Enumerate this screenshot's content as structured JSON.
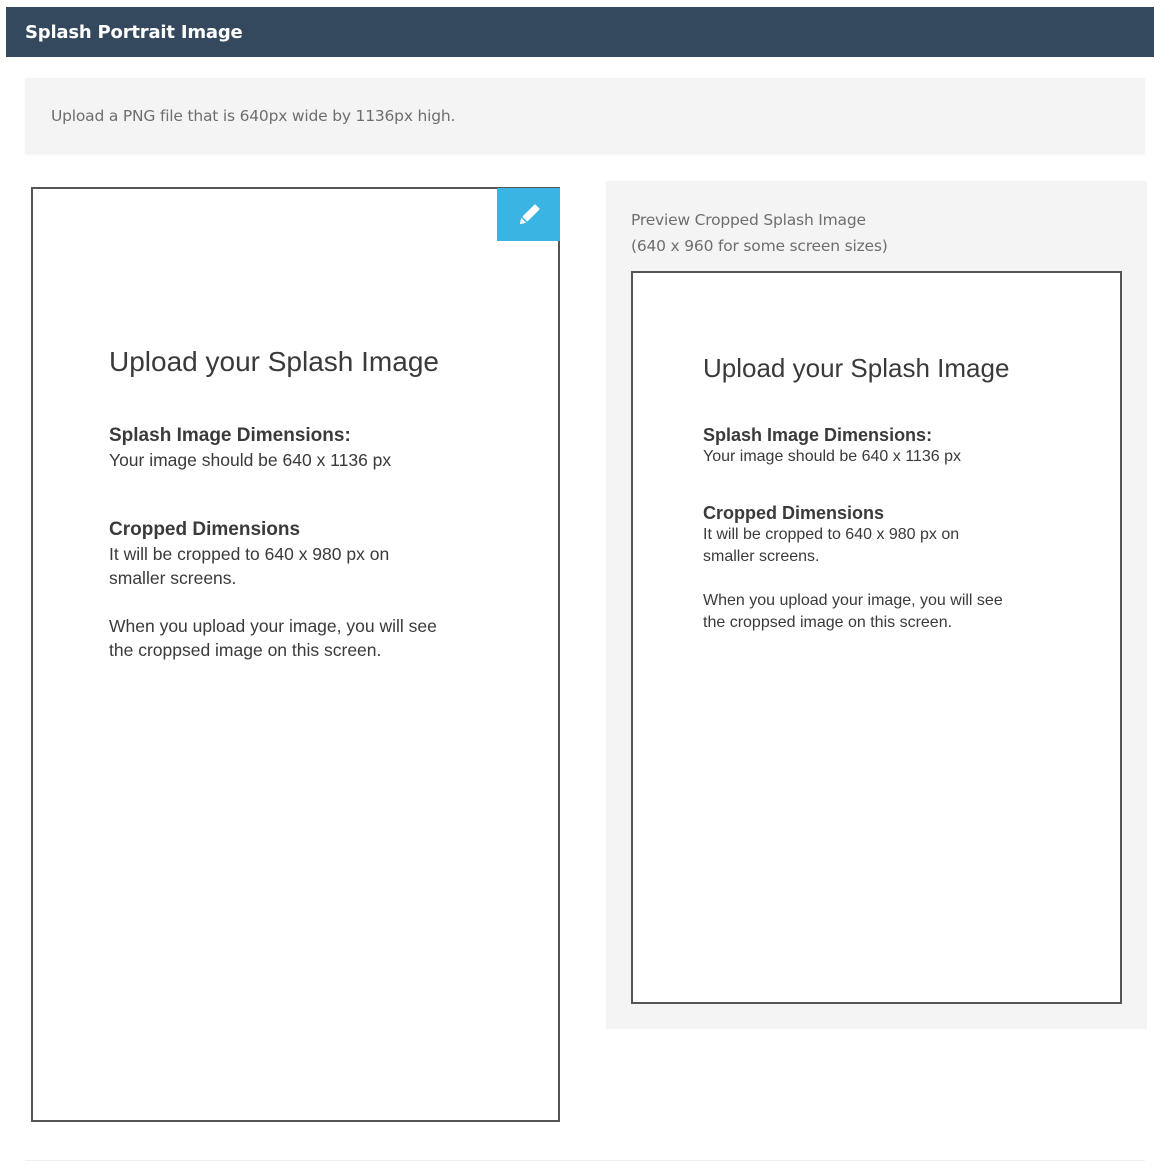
{
  "header": {
    "title": "Splash Portrait Image"
  },
  "info": {
    "text": "Upload a PNG file that is 640px wide by 1136px high."
  },
  "editor": {
    "edit_icon": "pencil-icon",
    "accent_color": "#3ab4e2"
  },
  "splash": {
    "heading": "Upload your Splash Image",
    "dimensions_title": "Splash Image Dimensions:",
    "dimensions_text": "Your image should be 640 x 1136 px",
    "cropped_title": "Cropped Dimensions",
    "cropped_text_line1": "It will be cropped to 640 x 980 px on",
    "cropped_text_line2": "smaller screens.",
    "note_line1": "When you upload your image, you will see",
    "note_line2": "the croppsed image on this screen."
  },
  "preview": {
    "caption_line1": "Preview Cropped Splash Image",
    "caption_line2": "(640 x 960 for some screen sizes)"
  },
  "colors": {
    "header_bg": "#34495e",
    "panel_bg": "#f4f4f4",
    "frame_border": "#555555"
  }
}
